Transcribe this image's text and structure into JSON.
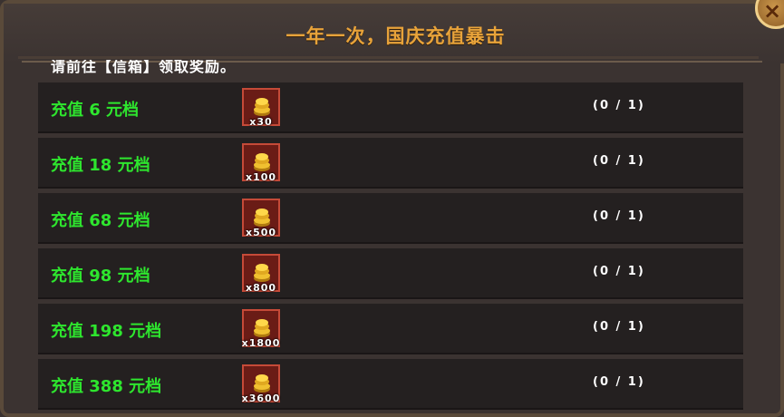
{
  "header": {
    "title": "一年一次，国庆充值暴击"
  },
  "close_button": {
    "icon": "close-icon",
    "label": "×"
  },
  "notice": "请前往【信箱】领取奖励。",
  "tiers": [
    {
      "label": "充值 6 元档",
      "item_icon": "gold-coin-icon",
      "quantity": "x30",
      "progress": "(0 / 1)"
    },
    {
      "label": "充值 18 元档",
      "item_icon": "gold-coin-icon",
      "quantity": "x100",
      "progress": "(0 / 1)"
    },
    {
      "label": "充值 68 元档",
      "item_icon": "gold-coin-icon",
      "quantity": "x500",
      "progress": "(0 / 1)"
    },
    {
      "label": "充值 98 元档",
      "item_icon": "gold-coin-icon",
      "quantity": "x800",
      "progress": "(0 / 1)"
    },
    {
      "label": "充值 198 元档",
      "item_icon": "gold-coin-icon",
      "quantity": "x1800",
      "progress": "(0 / 1)"
    },
    {
      "label": "充值 388 元档",
      "item_icon": "gold-coin-icon",
      "quantity": "x3600",
      "progress": "(0 / 1)"
    }
  ],
  "colors": {
    "title": "#e8a33a",
    "tier_label": "#2ee62e",
    "row_bg": "#242020",
    "panel_bg": "#3b3331"
  }
}
